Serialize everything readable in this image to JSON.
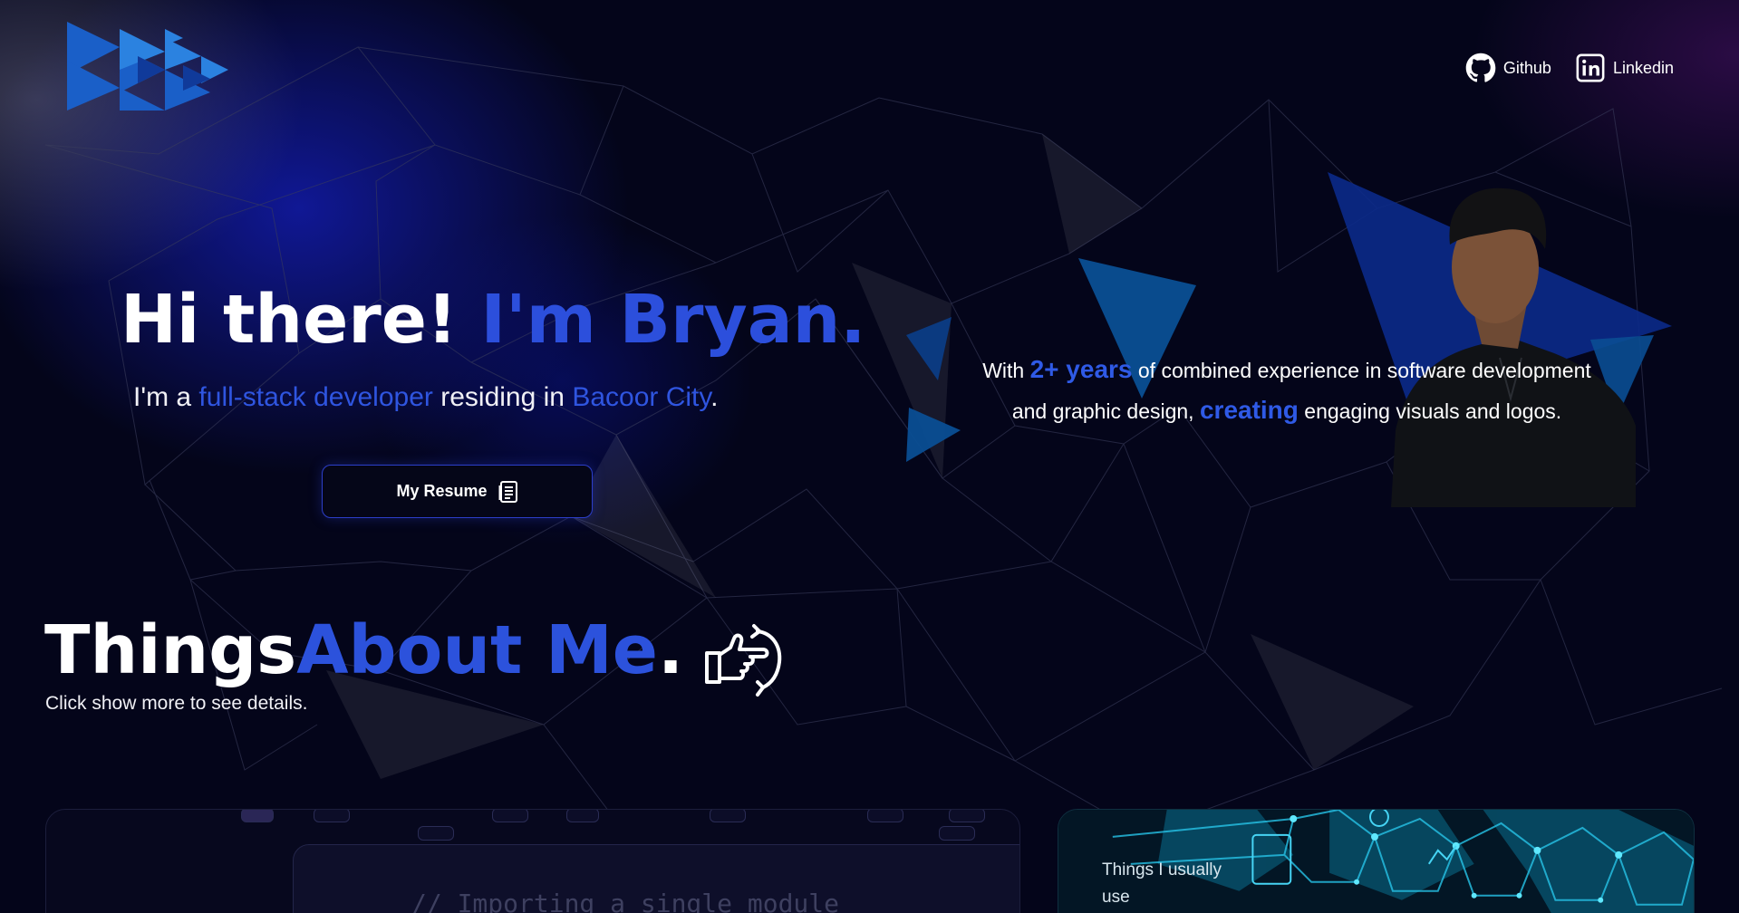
{
  "nav": {
    "github_label": "Github",
    "linkedin_label": "Linkedin"
  },
  "hero": {
    "title_plain": "Hi there! ",
    "title_accent": "I'm Bryan.",
    "sub_prefix": "I'm a ",
    "sub_role": "full-stack developer",
    "sub_middle": " residing in ",
    "sub_city": "Bacoor City",
    "sub_end": ".",
    "resume_label": "My Resume",
    "desc_1": "With ",
    "desc_years": "2+ years",
    "desc_2": " of combined experience in software development",
    "desc_3": "and graphic design, ",
    "desc_creating": "creating",
    "desc_4": " engaging visuals and logos."
  },
  "about": {
    "title_plain": "Things ",
    "title_accent": "About Me",
    "title_dot": ".",
    "subtitle": "Click show more to see details."
  },
  "cards": {
    "code_snippet": "// Importing a single module",
    "tools_label": "Things I usually use"
  },
  "colors": {
    "accent": "#2c4fdc",
    "background": "#04051a",
    "button_border": "#2c3ec9"
  },
  "icons": {
    "logo": "triangle-logo",
    "github": "github-icon",
    "linkedin": "linkedin-icon",
    "resume": "document-icon",
    "pointing": "pointing-hand-icon"
  }
}
